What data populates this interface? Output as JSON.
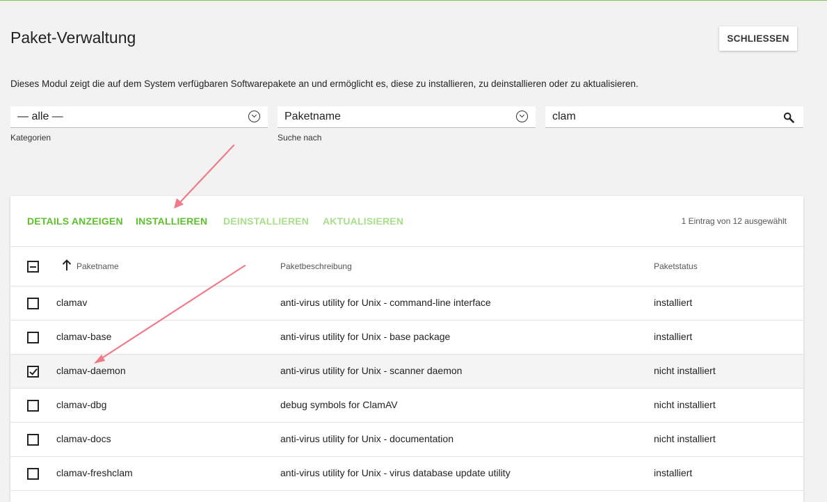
{
  "page": {
    "title": "Paket-Verwaltung",
    "close_label": "SCHLIESSEN",
    "description": "Dieses Modul zeigt die auf dem System verfügbaren Softwarepakete an und ermöglicht es, diese zu installieren, zu deinstallieren oder zu aktualisieren."
  },
  "filters": {
    "category": {
      "value": "— alle —",
      "label": "Kategorien"
    },
    "search_by": {
      "value": "Paketname",
      "label": "Suche nach"
    },
    "search": {
      "value": "clam"
    }
  },
  "toolbar": {
    "details": "DETAILS ANZEIGEN",
    "install": "INSTALLIEREN",
    "uninstall": "DEINSTALLIEREN",
    "update": "AKTUALISIEREN",
    "selection_count": "1 Eintrag von 12 ausgewählt"
  },
  "table": {
    "columns": [
      "Paketname",
      "Paketbeschreibung",
      "Paketstatus"
    ],
    "rows": [
      {
        "name": "clamav",
        "description": "anti-virus utility for Unix - command-line interface",
        "status": "installiert",
        "checked": false
      },
      {
        "name": "clamav-base",
        "description": "anti-virus utility for Unix - base package",
        "status": "installiert",
        "checked": false
      },
      {
        "name": "clamav-daemon",
        "description": "anti-virus utility for Unix - scanner daemon",
        "status": "nicht installiert",
        "checked": true
      },
      {
        "name": "clamav-dbg",
        "description": "debug symbols for ClamAV",
        "status": "nicht installiert",
        "checked": false
      },
      {
        "name": "clamav-docs",
        "description": "anti-virus utility for Unix - documentation",
        "status": "nicht installiert",
        "checked": false
      },
      {
        "name": "clamav-freshclam",
        "description": "anti-virus utility for Unix - virus database update utility",
        "status": "installiert",
        "checked": false
      }
    ]
  },
  "colors": {
    "accent": "#5ec02c",
    "accent_dim": "#a8df8b",
    "annotation": "#f07a8a"
  },
  "icons": {
    "dropdown": "chevron-down-circle-icon",
    "search": "search-icon",
    "sort": "arrow-up-icon"
  }
}
